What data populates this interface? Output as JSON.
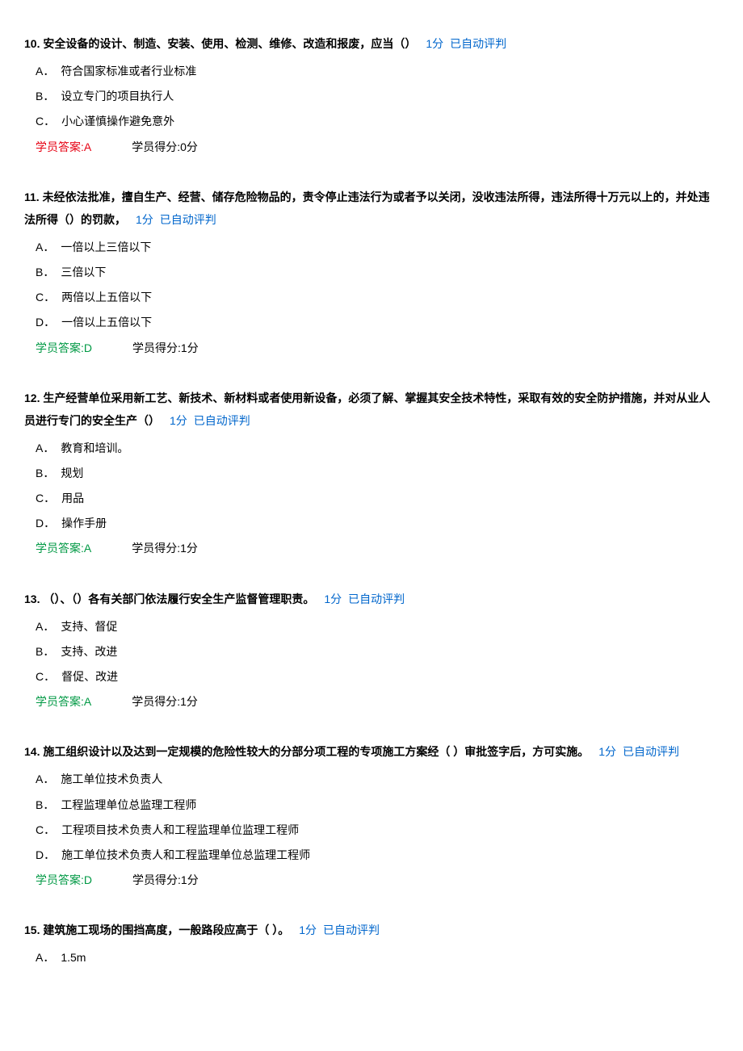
{
  "common": {
    "points": "1分",
    "autoJudge": "已自动评判",
    "answerLabel": "学员答案:",
    "scoreLabel": "学员得分:"
  },
  "questions": [
    {
      "number": "10.",
      "text": "安全设备的设计、制造、安装、使用、检测、维修、改造和报废，应当（）",
      "options": [
        {
          "label": "A．",
          "text": "符合国家标准或者行业标准"
        },
        {
          "label": "B．",
          "text": "设立专门的项目执行人"
        },
        {
          "label": "C．",
          "text": "小心谨慎操作避免意外"
        }
      ],
      "answer": "A",
      "score": "0分",
      "correct": false
    },
    {
      "number": "11.",
      "text": "未经依法批准，擅自生产、经营、储存危险物品的，责令停止违法行为或者予以关闭，没收违法所得，违法所得十万元以上的，并处违法所得（）的罚款，",
      "options": [
        {
          "label": "A．",
          "text": "一倍以上三倍以下"
        },
        {
          "label": "B．",
          "text": "三倍以下"
        },
        {
          "label": "C．",
          "text": "两倍以上五倍以下"
        },
        {
          "label": "D．",
          "text": "一倍以上五倍以下"
        }
      ],
      "answer": "D",
      "score": "1分",
      "correct": true
    },
    {
      "number": "12.",
      "text": "生产经营单位采用新工艺、新技术、新材料或者使用新设备，必须了解、掌握其安全技术特性，采取有效的安全防护措施，并对从业人员进行专门的安全生产（）",
      "options": [
        {
          "label": "A．",
          "text": "教育和培训。"
        },
        {
          "label": "B．",
          "text": "规划"
        },
        {
          "label": "C．",
          "text": "用品"
        },
        {
          "label": "D．",
          "text": "操作手册"
        }
      ],
      "answer": "A",
      "score": "1分",
      "correct": true
    },
    {
      "number": "13.",
      "text": "（）、（）各有关部门依法履行安全生产监督管理职责。",
      "options": [
        {
          "label": "A．",
          "text": "支持、督促"
        },
        {
          "label": "B．",
          "text": "支持、改进"
        },
        {
          "label": "C．",
          "text": "督促、改进"
        }
      ],
      "answer": "A",
      "score": "1分",
      "correct": true
    },
    {
      "number": "14.",
      "text": "施工组织设计以及达到一定规模的危险性较大的分部分项工程的专项施工方案经（  ）审批签字后，方可实施。",
      "options": [
        {
          "label": "A．",
          "text": "施工单位技术负责人"
        },
        {
          "label": "B．",
          "text": "工程监理单位总监理工程师"
        },
        {
          "label": "C．",
          "text": "工程项目技术负责人和工程监理单位监理工程师"
        },
        {
          "label": "D．",
          "text": "施工单位技术负责人和工程监理单位总监理工程师"
        }
      ],
      "answer": "D",
      "score": "1分",
      "correct": true
    },
    {
      "number": "15.",
      "text": "建筑施工现场的围挡高度，一般路段应高于（  ）。",
      "options": [
        {
          "label": "A．",
          "text": "1.5m"
        }
      ],
      "answer": "",
      "score": "",
      "correct": null
    }
  ]
}
